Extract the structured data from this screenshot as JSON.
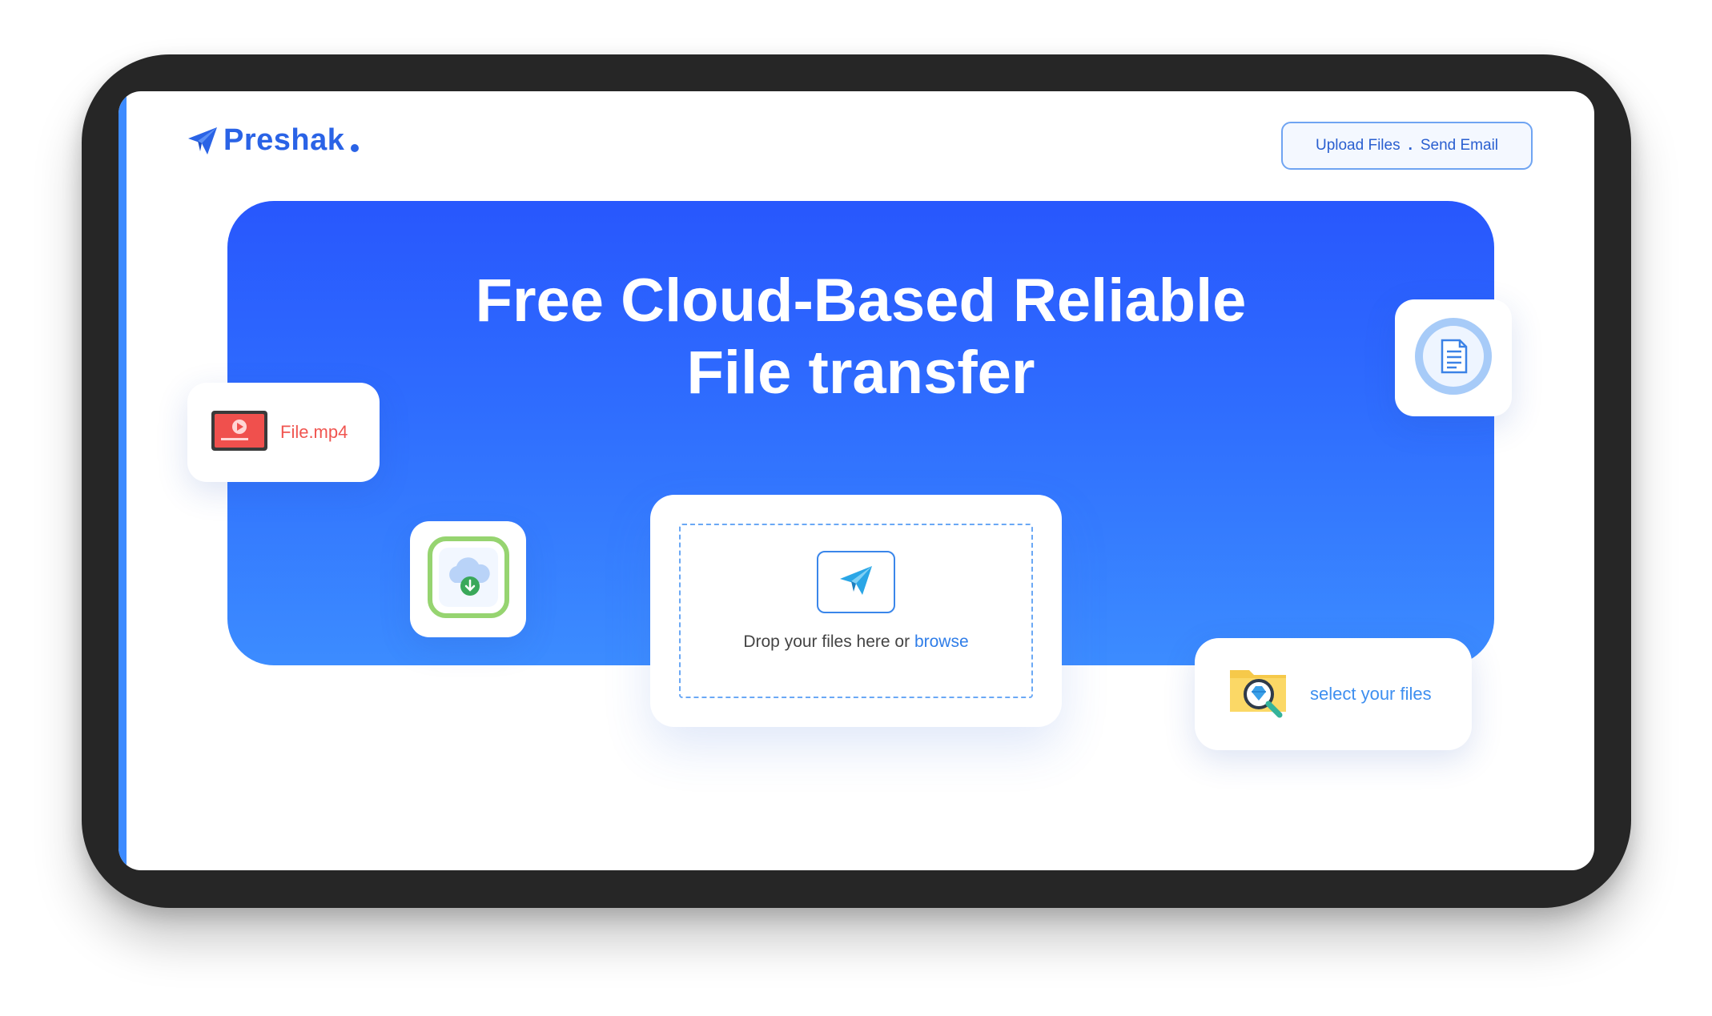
{
  "brand": {
    "name": "Preshak",
    "logo_icon": "paper-plane-icon"
  },
  "header": {
    "nav_upload": "Upload Files",
    "nav_separator": ".",
    "nav_email": "Send Email"
  },
  "hero": {
    "title_line1": "Free Cloud-Based Reliable",
    "title_line2": "File transfer"
  },
  "cards": {
    "video_file": {
      "label": "File.mp4",
      "icon": "video-file-icon"
    },
    "cloud_download": {
      "icon": "cloud-download-icon"
    },
    "document": {
      "icon": "document-icon"
    },
    "select_files": {
      "label": "select your files",
      "icon": "folder-search-icon"
    }
  },
  "dropzone": {
    "text": "Drop your files here or ",
    "browse_label": "browse",
    "icon": "paper-plane-icon"
  },
  "colors": {
    "brand": "#2a63e6",
    "hero_top": "#2857fd",
    "hero_bottom": "#3c8cff",
    "device_frame": "#262626",
    "mp4_accent": "#f05550",
    "cloud_accent": "#8fd16a"
  }
}
